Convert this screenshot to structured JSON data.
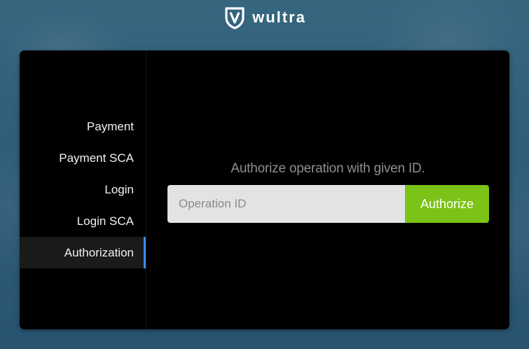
{
  "brand": {
    "name": "wultra",
    "logo_icon": "wultra-shield-icon"
  },
  "sidebar": {
    "items": [
      {
        "label": "Payment",
        "active": false
      },
      {
        "label": "Payment SCA",
        "active": false
      },
      {
        "label": "Login",
        "active": false
      },
      {
        "label": "Login SCA",
        "active": false
      },
      {
        "label": "Authorization",
        "active": true
      }
    ],
    "active_indicator_color": "#3a8ee6"
  },
  "main": {
    "prompt": "Authorize operation with given ID.",
    "operation_input": {
      "value": "",
      "placeholder": "Operation ID"
    },
    "authorize_label": "Authorize",
    "authorize_color": "#7bc316"
  }
}
